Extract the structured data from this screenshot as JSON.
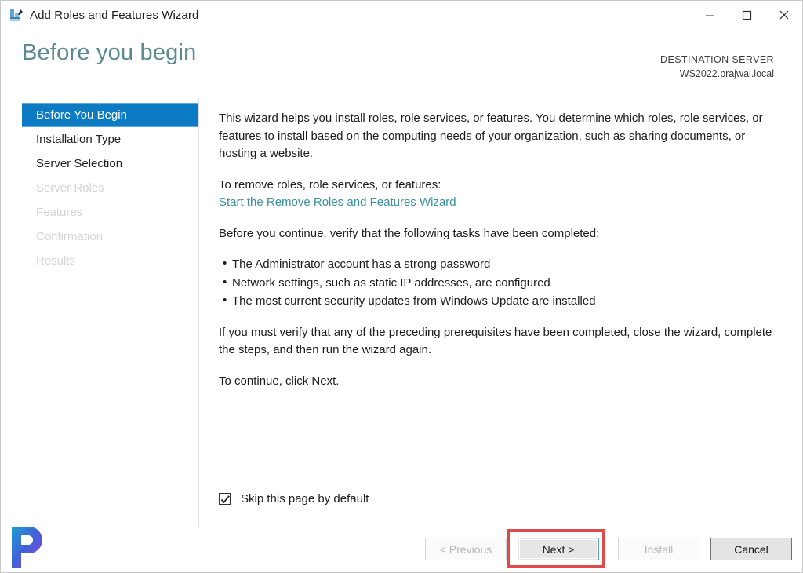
{
  "window": {
    "title": "Add Roles and Features Wizard",
    "icon": "server-manager-icon",
    "minimize_label": "Minimize",
    "maximize_label": "Maximize",
    "close_label": "Close"
  },
  "header": {
    "page_title": "Before you begin",
    "destination_label": "DESTINATION SERVER",
    "destination_server": "WS2022.prajwal.local"
  },
  "sidebar": {
    "items": [
      {
        "label": "Before You Begin",
        "state": "selected"
      },
      {
        "label": "Installation Type",
        "state": "enabled"
      },
      {
        "label": "Server Selection",
        "state": "enabled"
      },
      {
        "label": "Server Roles",
        "state": "disabled"
      },
      {
        "label": "Features",
        "state": "disabled"
      },
      {
        "label": "Confirmation",
        "state": "disabled"
      },
      {
        "label": "Results",
        "state": "disabled"
      }
    ]
  },
  "content": {
    "intro_paragraph": "This wizard helps you install roles, role services, or features. You determine which roles, role services, or features to install based on the computing needs of your organization, such as sharing documents, or hosting a website.",
    "remove_intro": "To remove roles, role services, or features:",
    "remove_link": "Start the Remove Roles and Features Wizard",
    "verify_intro": "Before you continue, verify that the following tasks have been completed:",
    "tasks": [
      "The Administrator account has a strong password",
      "Network settings, such as static IP addresses, are configured",
      "The most current security updates from Windows Update are installed"
    ],
    "prerequisites_paragraph": "If you must verify that any of the preceding prerequisites have been completed, close the wizard, complete the steps, and then run the wizard again.",
    "continue_paragraph": "To continue, click Next.",
    "skip_checkbox_label": "Skip this page by default",
    "skip_checkbox_checked": true
  },
  "footer": {
    "previous_label": "< Previous",
    "next_label": "Next >",
    "install_label": "Install",
    "cancel_label": "Cancel",
    "previous_enabled": false,
    "next_enabled": true,
    "install_enabled": false,
    "cancel_enabled": true
  },
  "annotation": {
    "highlight_target": "next-button",
    "highlight_color": "#e04a4a"
  },
  "watermark": {
    "logo_letter": "P"
  },
  "colors": {
    "selection_blue": "#0d7ac4",
    "title_teal": "#5c8a93",
    "link_teal": "#3a8f9e",
    "disabled_gray": "#d4d4d4",
    "annotation_red": "#e04a4a"
  }
}
